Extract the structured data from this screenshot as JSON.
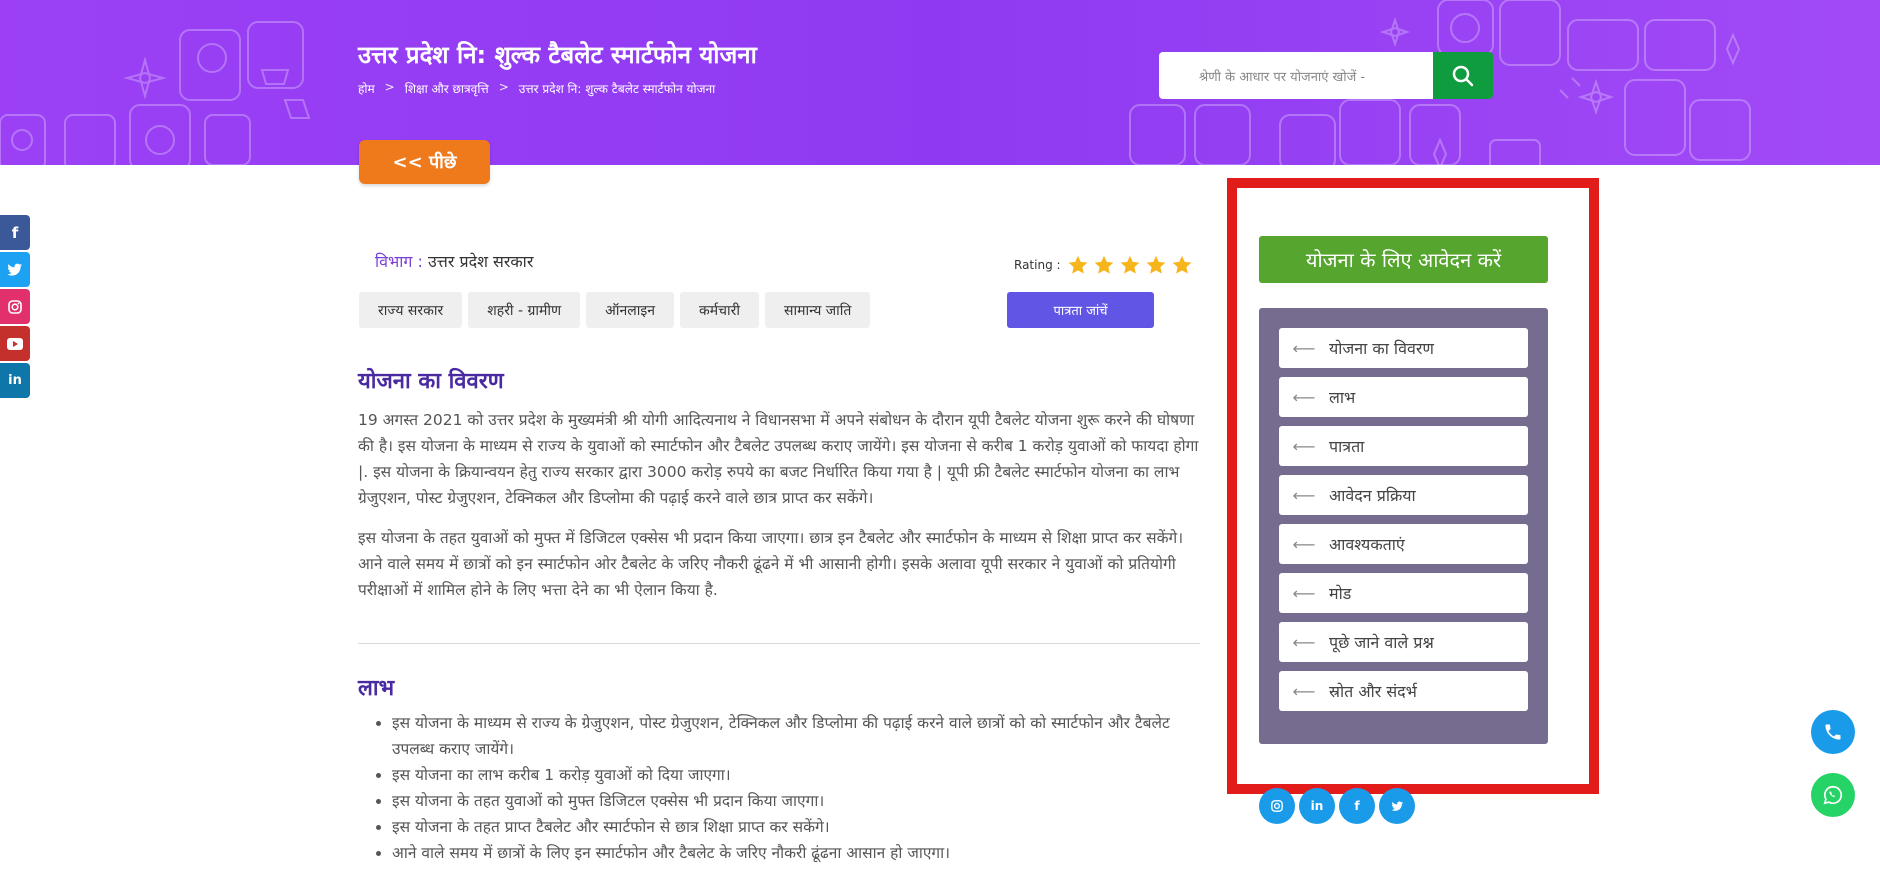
{
  "header": {
    "title": "उत्तर प्रदेश नि: शुल्क टैबलेट स्मार्टफोन योजना",
    "breadcrumb": [
      "होम",
      "शिक्षा और छात्रवृत्ति",
      "उत्तर प्रदेश नि: शुल्क टैबलेट स्मार्टफोन योजना"
    ],
    "breadcrumb_sep": ">",
    "search_placeholder": "श्रेणी के आधार पर योजनाएं खोजें -"
  },
  "back_label": "<< पीछे",
  "social_left": [
    "f",
    "t",
    "ig",
    "yt",
    "in"
  ],
  "meta": {
    "dept_key": "विभाग :",
    "dept_value": "उत्तर प्रदेश सरकार",
    "rating_label": "Rating :",
    "rating_stars": 5,
    "tags": [
      "राज्य सरकार",
      "शहरी - ग्रामीण",
      "ऑनलाइन",
      "कर्मचारी",
      "सामान्य जाति"
    ],
    "eligibility_label": "पात्रता जांचें"
  },
  "details": {
    "title": "योजना का विवरण",
    "para1": "19 अगस्त 2021 को उत्तर प्रदेश के मुख्यमंत्री श्री योगी आदित्यनाथ ने विधानसभा में अपने संबोधन के दौरान यूपी टैबलेट योजना शुरू करने की घोषणा की है। इस योजना के माध्यम से राज्य के युवाओं को स्मार्टफोन और टैबलेट उपलब्ध कराए जायेंगे। इस योजना से करीब 1 करोड़ युवाओं को फायदा होगा |. इस योजना के क्रियान्वयन हेतु राज्य सरकार द्वारा 3000 करोड़ रुपये का बजट निर्धारित किया गया है | यूपी फ्री टैबलेट स्मार्टफोन योजना का लाभ ग्रेजुएशन, पोस्ट ग्रेजुएशन, टेक्निकल और डिप्लोमा की पढ़ाई करने वाले छात्र प्राप्त कर सकेंगे।",
    "para2": "इस योजना के तहत युवाओं को मुफ्त में डिजिटल एक्सेस भी प्रदान किया जाएगा। छात्र इन टैबलेट और स्मार्टफोन के माध्यम से शिक्षा प्राप्त कर सकेंगे। आने वाले समय में छात्रों को इन स्मार्टफोन ओर टैबलेट के जरिए नौकरी ढूंढने में भी आसानी होगी। इसके अलावा यूपी सरकार ने युवाओं को प्रतियोगी परीक्षाओं में शामिल होने के लिए भत्ता देने का भी ऐलान किया है."
  },
  "benefits": {
    "title": "लाभ",
    "items": [
      "इस योजना के माध्यम से राज्य के ग्रेजुएशन, पोस्ट ग्रेजुएशन, टेक्निकल और डिप्लोमा की पढ़ाई करने वाले छात्रों को को स्मार्टफोन और टैबलेट उपलब्ध कराए जायेंगे।",
      "इस योजना का लाभ करीब 1 करोड़ युवाओं को दिया जाएगा।",
      "इस योजना के तहत युवाओं को मुफ्त डिजिटल एक्सेस भी प्रदान किया जाएगा।",
      "इस योजना के तहत प्राप्त टैबलेट और स्मार्टफोन से छात्र शिक्षा प्राप्त कर सकेंगे।",
      "आने वाले समय में छात्रों के लिए इन स्मार्टफोन और टैबलेट के जरिए नौकरी ढूंढना आसान हो जाएगा।"
    ]
  },
  "sidebar": {
    "apply_label": "योजना के लिए आवेदन करें",
    "toc": [
      "योजना का विवरण",
      "लाभ",
      "पात्रता",
      "आवेदन प्रक्रिया",
      "आवश्यकताएं",
      "मोड",
      "पूछे जाने वाले प्रश्न",
      "स्रोत और संदर्भ"
    ],
    "social": [
      "ig",
      "in",
      "f",
      "t"
    ]
  },
  "colors": {
    "banner": "#9b40f5",
    "accent_orange": "#ee7a1c",
    "apply_green": "#56a52e",
    "toc_bg": "#766c8f",
    "highlight_red": "#e21b1b",
    "heading_purple": "#4a2aa0"
  }
}
